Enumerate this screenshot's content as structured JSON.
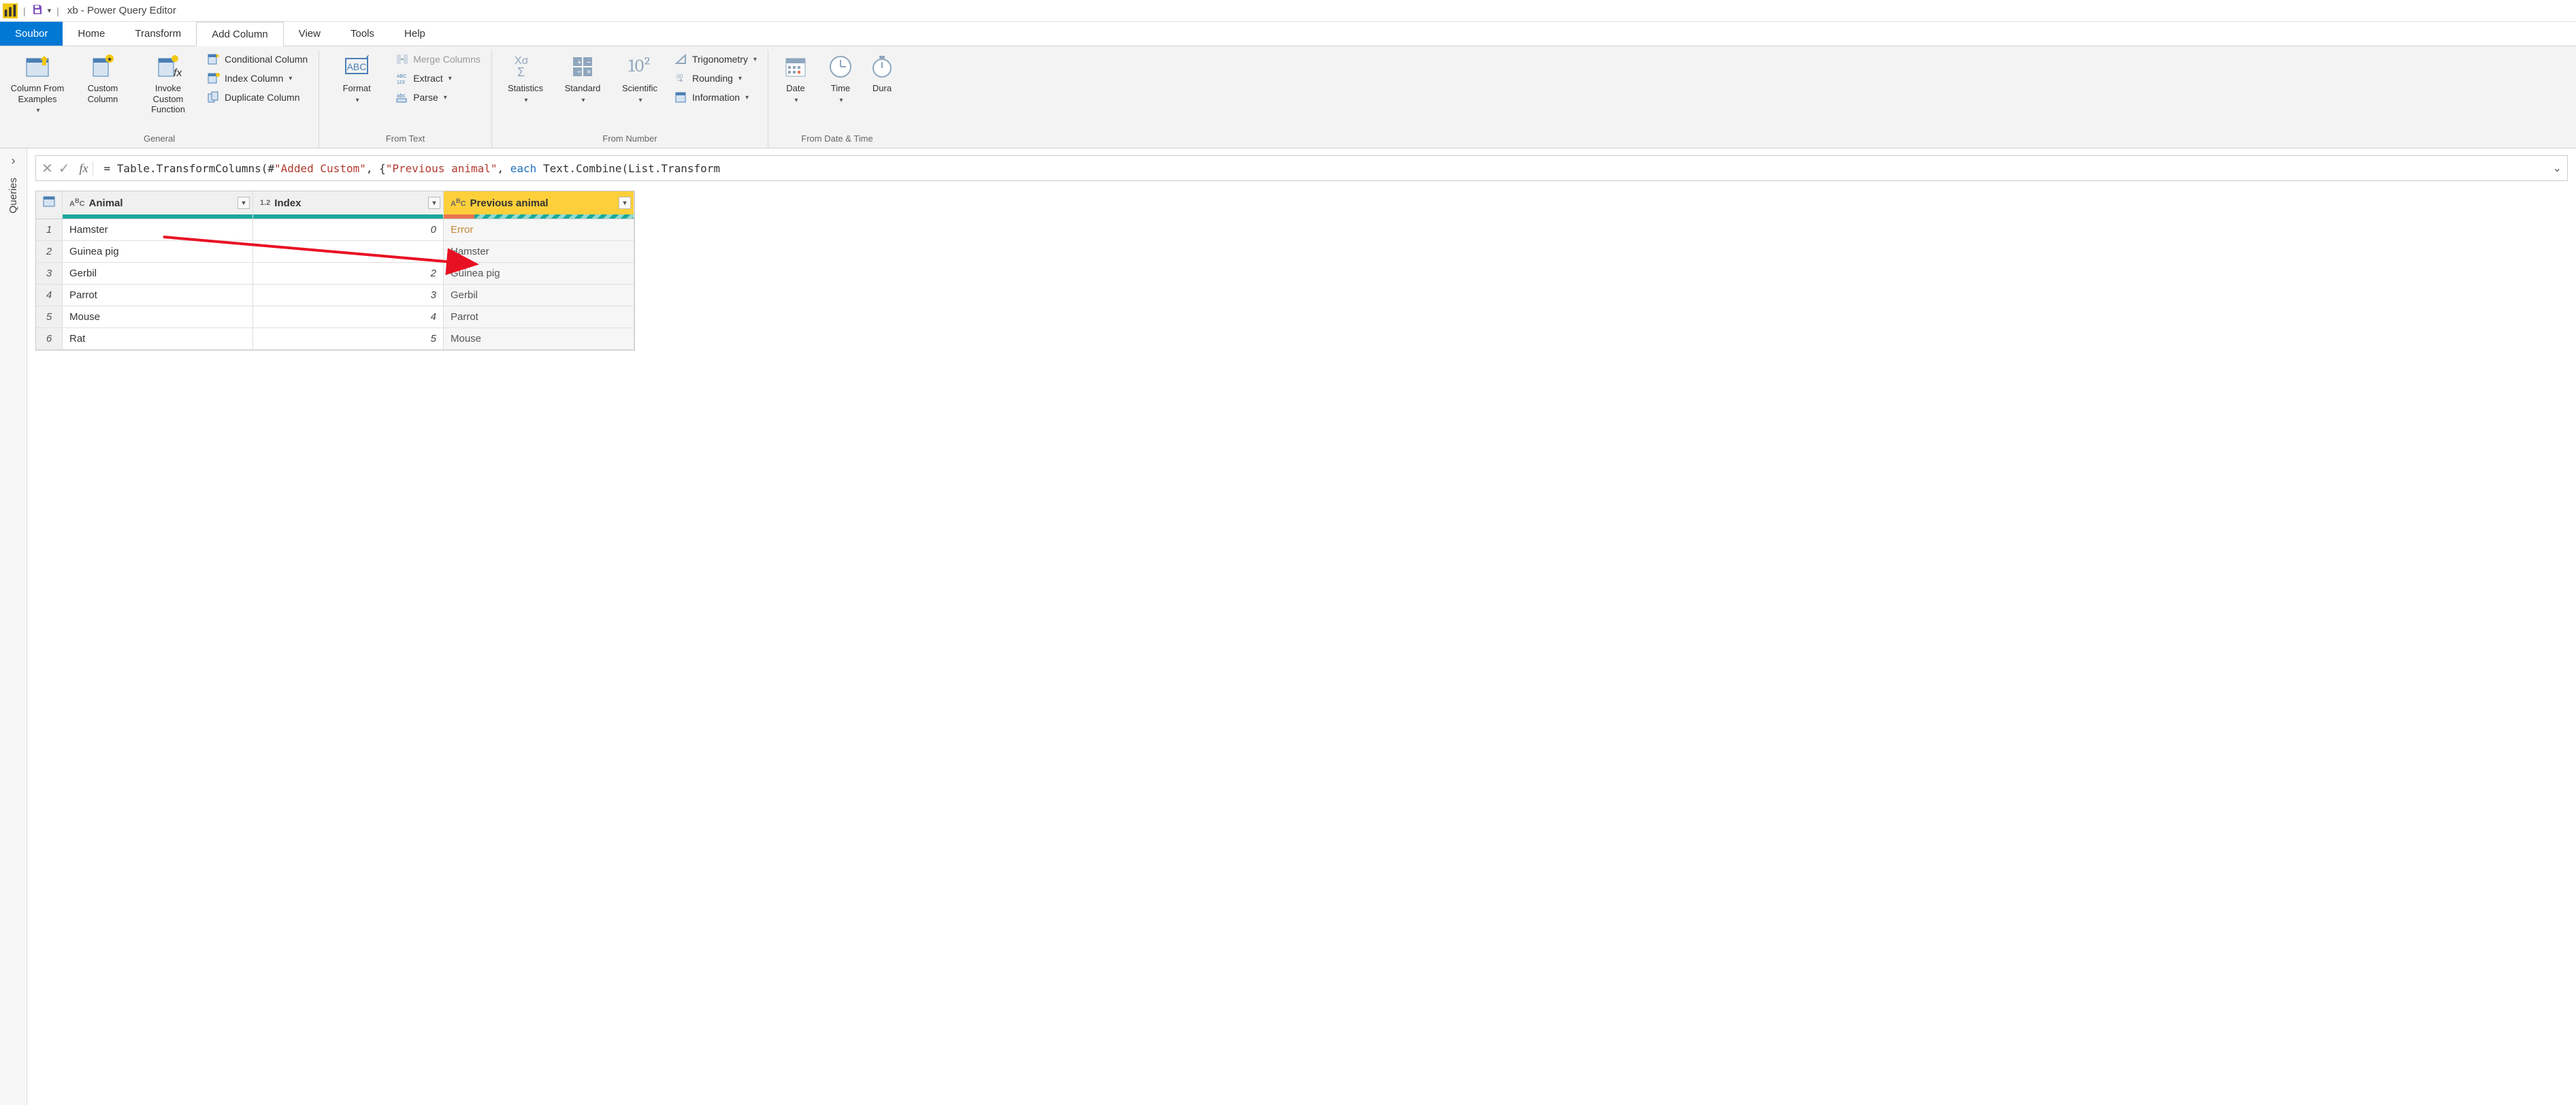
{
  "title": "xb - Power Query Editor",
  "menu": {
    "file": "Soubor",
    "tabs": [
      "Home",
      "Transform",
      "Add Column",
      "View",
      "Tools",
      "Help"
    ],
    "active": "Add Column"
  },
  "ribbon": {
    "general": {
      "label": "General",
      "col_from_examples": "Column From Examples",
      "custom_column": "Custom Column",
      "invoke_custom_fn": "Invoke Custom Function",
      "conditional_column": "Conditional Column",
      "index_column": "Index Column",
      "duplicate_column": "Duplicate Column"
    },
    "from_text": {
      "label": "From Text",
      "format": "Format",
      "merge_columns": "Merge Columns",
      "extract": "Extract",
      "parse": "Parse"
    },
    "from_number": {
      "label": "From Number",
      "statistics": "Statistics",
      "standard": "Standard",
      "scientific": "Scientific",
      "sci_icon": "10²",
      "trigonometry": "Trigonometry",
      "rounding": "Rounding",
      "information": "Information"
    },
    "from_dt": {
      "label": "From Date & Time",
      "date": "Date",
      "time": "Time",
      "duration": "Dura"
    }
  },
  "queries_panel": {
    "label": "Queries"
  },
  "formula": {
    "prefix": "= Table.TransformColumns(#",
    "str1": "\"Added Custom\"",
    "mid": ", {",
    "str2": "\"Previous animal\"",
    "mid2": ", ",
    "kw": "each",
    "suffix": " Text.Combine(List.Transform"
  },
  "grid": {
    "columns": [
      {
        "name": "Animal",
        "type": "ABC"
      },
      {
        "name": "Index",
        "type": "1.2"
      },
      {
        "name": "Previous animal",
        "type": "ABC",
        "selected": true
      }
    ],
    "rows": [
      {
        "n": 1,
        "animal": "Hamster",
        "index": "0",
        "prev": "Error",
        "err": true
      },
      {
        "n": 2,
        "animal": "Guinea pig",
        "index": "",
        "prev": "Hamster"
      },
      {
        "n": 3,
        "animal": "Gerbil",
        "index": "2",
        "prev": "Guinea pig"
      },
      {
        "n": 4,
        "animal": "Parrot",
        "index": "3",
        "prev": "Gerbil"
      },
      {
        "n": 5,
        "animal": "Mouse",
        "index": "4",
        "prev": "Parrot"
      },
      {
        "n": 6,
        "animal": "Rat",
        "index": "5",
        "prev": "Mouse"
      }
    ]
  }
}
